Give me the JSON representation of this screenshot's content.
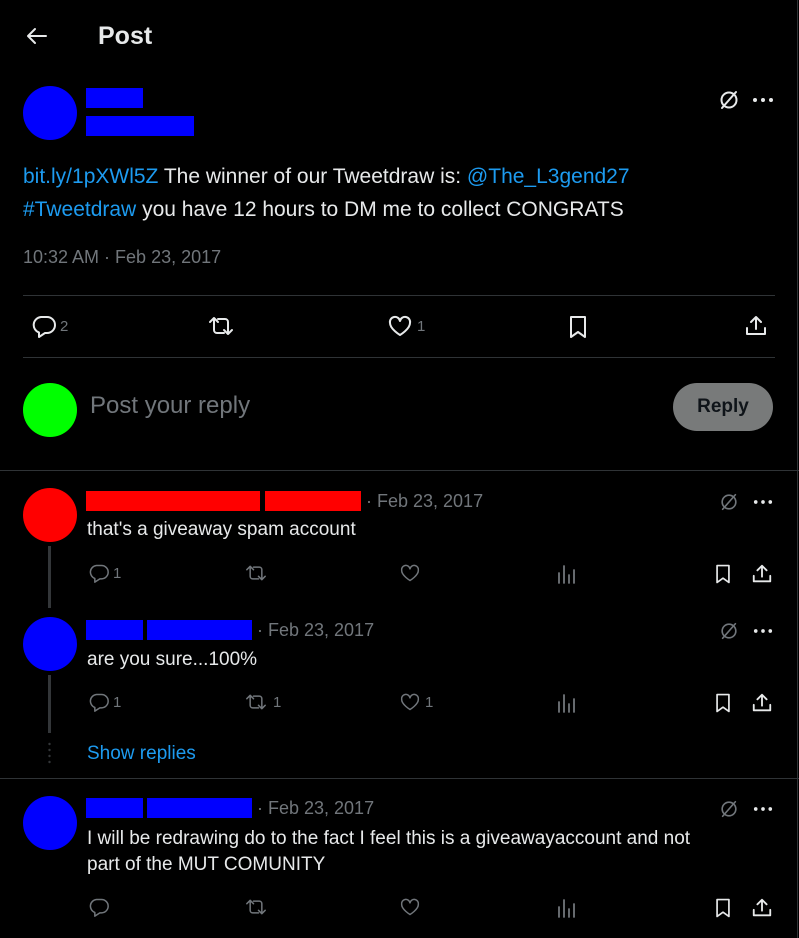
{
  "header": {
    "title": "Post"
  },
  "colors": {
    "blue": "#1d9bf0",
    "avatar_blue": "#0000ff",
    "avatar_green": "#00ff00",
    "avatar_red": "#ff0000"
  },
  "post": {
    "link": "bit.ly/1pXWl5Z",
    "text1": " The winner of our Tweetdraw is: ",
    "mention": "@The_L3gend27",
    "hashtag": "#Tweetdraw",
    "text2": " you have 12 hours to DM me to collect CONGRATS",
    "timestamp": "10:32 AM · Feb 23, 2017",
    "replies": "2",
    "likes": "1"
  },
  "compose": {
    "placeholder": "Post your reply",
    "button": "Reply"
  },
  "replies": [
    {
      "date": "· Feb 23, 2017",
      "text": "that's a giveaway spam account",
      "reply_count": "1",
      "repost_count": "",
      "like_count": ""
    },
    {
      "date": "· Feb 23, 2017",
      "text": "are you sure...100%",
      "reply_count": "1",
      "repost_count": "1",
      "like_count": "1"
    },
    {
      "date": "· Feb 23, 2017",
      "text_line1": "I will be redrawing do to the fact I feel this is a giveawayaccount and not",
      "text_line2": "part of the MUT COMUNITY",
      "reply_count": "",
      "repost_count": "",
      "like_count": ""
    }
  ],
  "show_replies": "Show replies"
}
